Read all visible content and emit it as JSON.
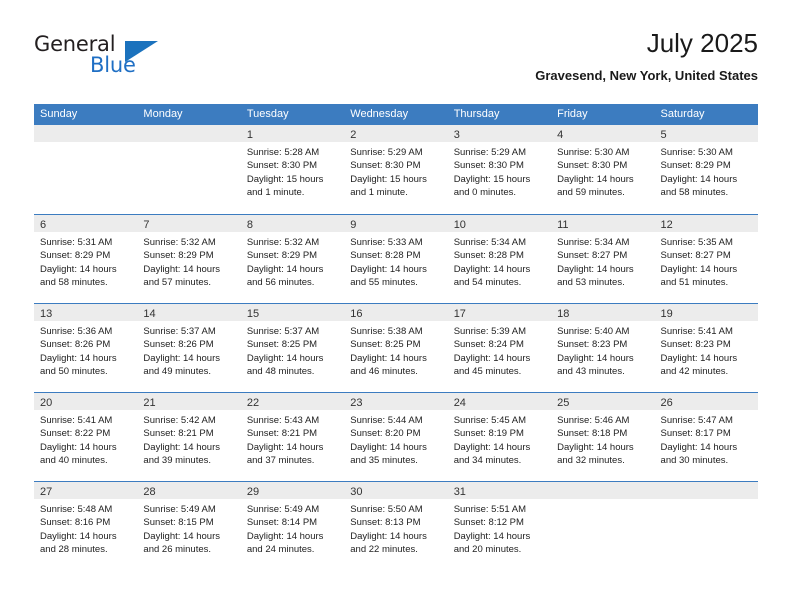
{
  "brand": {
    "name_part1": "General",
    "name_part2": "Blue",
    "logo_icon": "triangle-logo-icon"
  },
  "header": {
    "title": "July 2025",
    "location": "Gravesend, New York, United States"
  },
  "colors": {
    "header_blue": "#3c7cc0",
    "band_grey": "#ececec",
    "brand_blue": "#1f6fc4",
    "text": "#222222"
  },
  "weekdays": [
    "Sunday",
    "Monday",
    "Tuesday",
    "Wednesday",
    "Thursday",
    "Friday",
    "Saturday"
  ],
  "weeks": [
    [
      {
        "day": "",
        "sunrise": "",
        "sunset": "",
        "daylight1": "",
        "daylight2": ""
      },
      {
        "day": "",
        "sunrise": "",
        "sunset": "",
        "daylight1": "",
        "daylight2": ""
      },
      {
        "day": "1",
        "sunrise": "Sunrise: 5:28 AM",
        "sunset": "Sunset: 8:30 PM",
        "daylight1": "Daylight: 15 hours",
        "daylight2": "and 1 minute."
      },
      {
        "day": "2",
        "sunrise": "Sunrise: 5:29 AM",
        "sunset": "Sunset: 8:30 PM",
        "daylight1": "Daylight: 15 hours",
        "daylight2": "and 1 minute."
      },
      {
        "day": "3",
        "sunrise": "Sunrise: 5:29 AM",
        "sunset": "Sunset: 8:30 PM",
        "daylight1": "Daylight: 15 hours",
        "daylight2": "and 0 minutes."
      },
      {
        "day": "4",
        "sunrise": "Sunrise: 5:30 AM",
        "sunset": "Sunset: 8:30 PM",
        "daylight1": "Daylight: 14 hours",
        "daylight2": "and 59 minutes."
      },
      {
        "day": "5",
        "sunrise": "Sunrise: 5:30 AM",
        "sunset": "Sunset: 8:29 PM",
        "daylight1": "Daylight: 14 hours",
        "daylight2": "and 58 minutes."
      }
    ],
    [
      {
        "day": "6",
        "sunrise": "Sunrise: 5:31 AM",
        "sunset": "Sunset: 8:29 PM",
        "daylight1": "Daylight: 14 hours",
        "daylight2": "and 58 minutes."
      },
      {
        "day": "7",
        "sunrise": "Sunrise: 5:32 AM",
        "sunset": "Sunset: 8:29 PM",
        "daylight1": "Daylight: 14 hours",
        "daylight2": "and 57 minutes."
      },
      {
        "day": "8",
        "sunrise": "Sunrise: 5:32 AM",
        "sunset": "Sunset: 8:29 PM",
        "daylight1": "Daylight: 14 hours",
        "daylight2": "and 56 minutes."
      },
      {
        "day": "9",
        "sunrise": "Sunrise: 5:33 AM",
        "sunset": "Sunset: 8:28 PM",
        "daylight1": "Daylight: 14 hours",
        "daylight2": "and 55 minutes."
      },
      {
        "day": "10",
        "sunrise": "Sunrise: 5:34 AM",
        "sunset": "Sunset: 8:28 PM",
        "daylight1": "Daylight: 14 hours",
        "daylight2": "and 54 minutes."
      },
      {
        "day": "11",
        "sunrise": "Sunrise: 5:34 AM",
        "sunset": "Sunset: 8:27 PM",
        "daylight1": "Daylight: 14 hours",
        "daylight2": "and 53 minutes."
      },
      {
        "day": "12",
        "sunrise": "Sunrise: 5:35 AM",
        "sunset": "Sunset: 8:27 PM",
        "daylight1": "Daylight: 14 hours",
        "daylight2": "and 51 minutes."
      }
    ],
    [
      {
        "day": "13",
        "sunrise": "Sunrise: 5:36 AM",
        "sunset": "Sunset: 8:26 PM",
        "daylight1": "Daylight: 14 hours",
        "daylight2": "and 50 minutes."
      },
      {
        "day": "14",
        "sunrise": "Sunrise: 5:37 AM",
        "sunset": "Sunset: 8:26 PM",
        "daylight1": "Daylight: 14 hours",
        "daylight2": "and 49 minutes."
      },
      {
        "day": "15",
        "sunrise": "Sunrise: 5:37 AM",
        "sunset": "Sunset: 8:25 PM",
        "daylight1": "Daylight: 14 hours",
        "daylight2": "and 48 minutes."
      },
      {
        "day": "16",
        "sunrise": "Sunrise: 5:38 AM",
        "sunset": "Sunset: 8:25 PM",
        "daylight1": "Daylight: 14 hours",
        "daylight2": "and 46 minutes."
      },
      {
        "day": "17",
        "sunrise": "Sunrise: 5:39 AM",
        "sunset": "Sunset: 8:24 PM",
        "daylight1": "Daylight: 14 hours",
        "daylight2": "and 45 minutes."
      },
      {
        "day": "18",
        "sunrise": "Sunrise: 5:40 AM",
        "sunset": "Sunset: 8:23 PM",
        "daylight1": "Daylight: 14 hours",
        "daylight2": "and 43 minutes."
      },
      {
        "day": "19",
        "sunrise": "Sunrise: 5:41 AM",
        "sunset": "Sunset: 8:23 PM",
        "daylight1": "Daylight: 14 hours",
        "daylight2": "and 42 minutes."
      }
    ],
    [
      {
        "day": "20",
        "sunrise": "Sunrise: 5:41 AM",
        "sunset": "Sunset: 8:22 PM",
        "daylight1": "Daylight: 14 hours",
        "daylight2": "and 40 minutes."
      },
      {
        "day": "21",
        "sunrise": "Sunrise: 5:42 AM",
        "sunset": "Sunset: 8:21 PM",
        "daylight1": "Daylight: 14 hours",
        "daylight2": "and 39 minutes."
      },
      {
        "day": "22",
        "sunrise": "Sunrise: 5:43 AM",
        "sunset": "Sunset: 8:21 PM",
        "daylight1": "Daylight: 14 hours",
        "daylight2": "and 37 minutes."
      },
      {
        "day": "23",
        "sunrise": "Sunrise: 5:44 AM",
        "sunset": "Sunset: 8:20 PM",
        "daylight1": "Daylight: 14 hours",
        "daylight2": "and 35 minutes."
      },
      {
        "day": "24",
        "sunrise": "Sunrise: 5:45 AM",
        "sunset": "Sunset: 8:19 PM",
        "daylight1": "Daylight: 14 hours",
        "daylight2": "and 34 minutes."
      },
      {
        "day": "25",
        "sunrise": "Sunrise: 5:46 AM",
        "sunset": "Sunset: 8:18 PM",
        "daylight1": "Daylight: 14 hours",
        "daylight2": "and 32 minutes."
      },
      {
        "day": "26",
        "sunrise": "Sunrise: 5:47 AM",
        "sunset": "Sunset: 8:17 PM",
        "daylight1": "Daylight: 14 hours",
        "daylight2": "and 30 minutes."
      }
    ],
    [
      {
        "day": "27",
        "sunrise": "Sunrise: 5:48 AM",
        "sunset": "Sunset: 8:16 PM",
        "daylight1": "Daylight: 14 hours",
        "daylight2": "and 28 minutes."
      },
      {
        "day": "28",
        "sunrise": "Sunrise: 5:49 AM",
        "sunset": "Sunset: 8:15 PM",
        "daylight1": "Daylight: 14 hours",
        "daylight2": "and 26 minutes."
      },
      {
        "day": "29",
        "sunrise": "Sunrise: 5:49 AM",
        "sunset": "Sunset: 8:14 PM",
        "daylight1": "Daylight: 14 hours",
        "daylight2": "and 24 minutes."
      },
      {
        "day": "30",
        "sunrise": "Sunrise: 5:50 AM",
        "sunset": "Sunset: 8:13 PM",
        "daylight1": "Daylight: 14 hours",
        "daylight2": "and 22 minutes."
      },
      {
        "day": "31",
        "sunrise": "Sunrise: 5:51 AM",
        "sunset": "Sunset: 8:12 PM",
        "daylight1": "Daylight: 14 hours",
        "daylight2": "and 20 minutes."
      },
      {
        "day": "",
        "sunrise": "",
        "sunset": "",
        "daylight1": "",
        "daylight2": ""
      },
      {
        "day": "",
        "sunrise": "",
        "sunset": "",
        "daylight1": "",
        "daylight2": ""
      }
    ]
  ]
}
